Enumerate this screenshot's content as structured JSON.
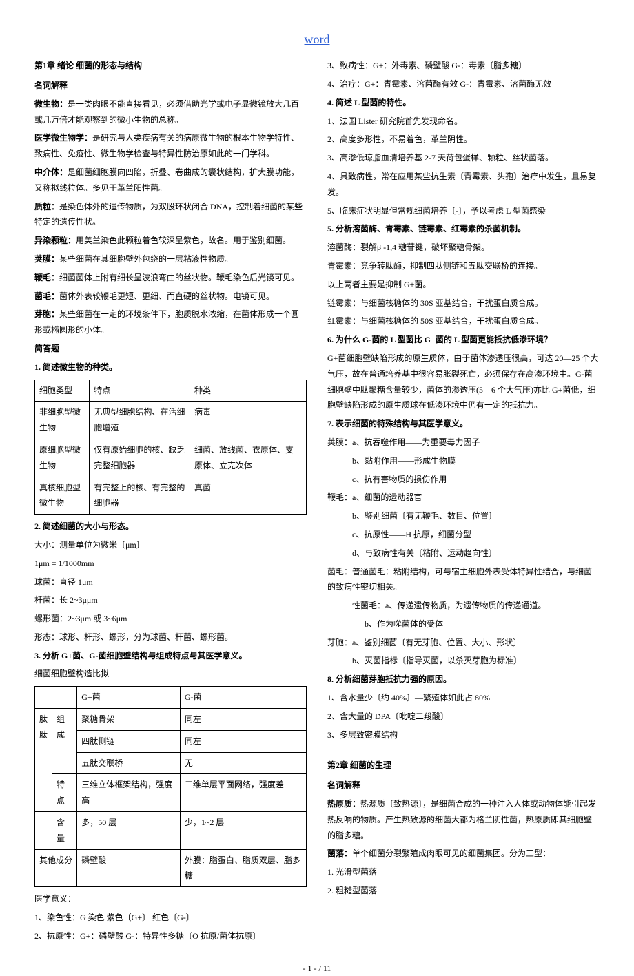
{
  "header": "word",
  "left": {
    "chapter": "第1章 绪论 细菌的形态与结构",
    "sec1": "名词解释",
    "terms": [
      {
        "t": "微生物：",
        "d": "是一类肉眼不能直接看见，必须借助光学或电子显微镜放大几百或几万倍才能观察到的微小生物的总称。"
      },
      {
        "t": "医学微生物学：",
        "d": "是研究与人类疾病有关的病原微生物的根本生物学特性、致病性、免疫性、微生物学检查与特异性防治原如此的一门学科。"
      },
      {
        "t": "中介体：",
        "d": "是细菌细胞膜向凹陷，折叠、卷曲成的囊状结构，扩大膜功能，又称拟线粒体。多见于革兰阳性菌。"
      },
      {
        "t": "质粒：",
        "d": "是染色体外的遗传物质，为双股环状闭合 DNA，控制着细菌的某些特定的遗传性状。"
      },
      {
        "t": "异染颗粒：",
        "d": "用美兰染色此颗粒着色较深呈紫色，故名。用于鉴别细菌。"
      },
      {
        "t": "荚膜：",
        "d": "某些细菌在其细胞壁外包绕的一层粘液性物质。"
      },
      {
        "t": "鞭毛：",
        "d": "细菌菌体上附有细长呈波浪弯曲的丝状物。鞭毛染色后光镜可见。"
      },
      {
        "t": "菌毛：",
        "d": "菌体外表较鞭毛更短、更细、而直硬的丝状物。电镜可见。"
      },
      {
        "t": "芽胞：",
        "d": "某些细菌在一定的环境条件下，胞质脱水浓缩，在菌体形成一个圆形或椭圆形的小体。"
      }
    ],
    "sec2": "简答题",
    "q1": "1. 简述微生物的种类。",
    "table1": {
      "header": [
        "细胞类型",
        "特点",
        "种类"
      ],
      "rows": [
        [
          "非细胞型微生物",
          "无典型细胞结构、在活细胞增殖",
          "病毒"
        ],
        [
          "原细胞型微生物",
          "仅有原始细胞的核、缺乏完整细胞器",
          "细菌、放线菌、衣原体、支原体、立克次体"
        ],
        [
          "真核细胞型微生物",
          "有完整上的核、有完整的细胞器",
          "真菌"
        ]
      ]
    },
    "q2": "2. 简述细菌的大小与形态。",
    "q2lines": [
      "大小：测量单位为微米〔μm〕",
      "1μm = 1/1000mm",
      "球菌：直径 1μm",
      "杆菌：长 2~3μμm",
      "螺形菌：2~3μm 或 3~6μm",
      "形态：球形、杆形、螺形，分为球菌、杆菌、螺形菌。"
    ],
    "q3": "3. 分析 G+菌、G-菌细胞壁结构与组成特点与其医学意义。",
    "q3pre": "细菌细胞壁构造比拟",
    "table2": {
      "r1": [
        "",
        "",
        "G+菌",
        "G-菌"
      ],
      "r2": [
        "肽",
        "组成",
        "聚糖骨架",
        "同左"
      ],
      "r3": [
        "",
        "",
        "四肽侧链",
        "同左"
      ],
      "r4": [
        "肽",
        "",
        "五肽交联桥",
        "无"
      ],
      "r5": [
        "肽",
        "特点",
        "三维立体框架结构，强度高",
        "二维单层平面网络，强度差"
      ],
      "r6": [
        "",
        "含量",
        "多，50 层",
        "少，1~2 层"
      ],
      "r7": [
        "其他成分",
        "",
        "磷壁酸",
        "外膜：脂蛋白、脂质双层、脂多糖"
      ]
    },
    "q3post": [
      "医学意义：",
      "1、染色性：G 染色 紫色〔G+〕  红色〔G-〕",
      "2、抗原性：G+：磷壁酸 G-：特异性多糖〔O 抗原/菌体抗原〕"
    ]
  },
  "right": {
    "pre": [
      "3、致病性：G+：外毒素、磷壁酸 G-：毒素〔脂多糖〕",
      "4、治疗：G+：青霉素、溶菌酶有效 G-：青霉素、溶菌酶无效"
    ],
    "q4": "4. 简述 L 型菌的特性。",
    "q4lines": [
      "1、法国 Lister 研究院首先发现命名。",
      "2、高度多形性，不易着色，革兰阴性。",
      "3、高渗低琼脂血清培养基 2-7 天荷包蛋样、颗粒、丝状菌落。",
      "4、具致病性，常在应用某些抗生素〔青霉素、头孢〕治疗中发生，且易复发。",
      "5、临床症状明显但常规细菌培养〔-〕，予以考虑 L 型菌感染"
    ],
    "q5": "5. 分析溶菌酶、青霉素、链霉素、红霉素的杀菌机制。",
    "q5lines": [
      "溶菌酶：裂解β -1,4 糖苷键，破坏聚糖骨架。",
      "青霉素：竞争转肽酶，抑制四肽侧链和五肽交联桥的连接。",
      "以上两者主要是抑制 G+菌。",
      "链霉素：与细菌核糖体的 30S 亚基结合，干扰蛋白质合成。",
      "红霉素：与细菌核糖体的 50S 亚基结合，干扰蛋白质合成。"
    ],
    "q6": "6. 为什么 G-菌的 L 型菌比 G+菌的 L 型菌更能抵抗低渗环境？",
    "q6body": "G+菌细胞壁缺陷形成的原生质体，由于菌体渗透压很高，可达 20—25 个大气压，故在普通培养基中很容易胀裂死亡，必须保存在高渗环境中。G-菌细胞壁中肽聚糖含量较少，菌体的渗透压(5—6 个大气压)亦比 G+菌低，细胞壁缺陷形成的原生质球在低渗环境中仍有一定的抵抗力。",
    "q7": "7. 表示细菌的特殊结构与其医学意义。",
    "q7lines": [
      {
        "pre": "荚膜：",
        "items": [
          "a、抗吞噬作用——为重要毒力因子",
          "b、黏附作用——形成生物膜",
          "c、抗有害物质的损伤作用"
        ]
      },
      {
        "pre": "鞭毛：",
        "items": [
          "a、细菌的运动器官",
          "b、鉴别细菌〔有无鞭毛、数目、位置〕",
          "c、抗原性——H 抗原，细菌分型",
          "d、与致病性有关〔粘附、运动趋向性〕"
        ]
      }
    ],
    "jm": "菌毛：普通菌毛：粘附结构，可与宿主细胞外表受体特异性结合，与细菌的致病性密切相关。",
    "xjm": [
      "性菌毛：a、传递遗传物质，为遗传物质的传递通道。",
      "b、作为噬菌体的受体"
    ],
    "yb": [
      "芽胞：a、鉴别细菌〔有无芽胞、位置、大小、形状〕",
      "b、灭菌指标〔指导灭菌，以杀灭芽胞为标准〕"
    ],
    "q8": "8. 分析细菌芽胞抵抗力强的原因。",
    "q8lines": [
      "1、含水量少〔约 40%〕—繁殖体如此占 80%",
      "2、含大量的 DPA〔吡啶二羧酸〕",
      "3、多层致密膜结构"
    ],
    "chapter2": "第2章 细菌的生理",
    "sec2_1": "名词解释",
    "terms2": [
      {
        "t": "热原质：",
        "d": "热源质〔致热源〕，是细菌合成的一种注入人体或动物体能引起发热反响的物质。产生热致源的细菌大都为格兰阴性菌，热原质即其细胞壁的脂多糖。"
      },
      {
        "t": "菌落：",
        "d": "单个细菌分裂繁殖成肉眼可见的细菌集团。分为三型："
      }
    ],
    "ml": [
      "1.    光滑型菌落",
      "2.    粗糙型菌落"
    ]
  },
  "footer": "- 1 -  / 11"
}
